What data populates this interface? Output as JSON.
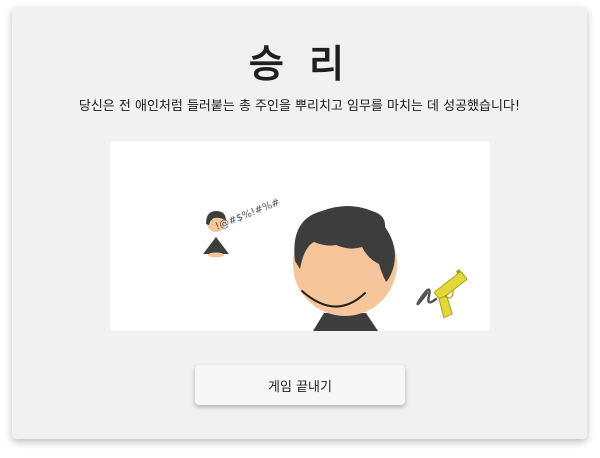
{
  "result": {
    "title": "승 리",
    "message": "당신은 전 애인처럼 들러붙는 총 주인을 뿌리치고 임무를 마치는 데 성공했습니다!"
  },
  "scene": {
    "curse_text": "!@#$%!#%#",
    "colors": {
      "hair": "#3d3d3d",
      "skin": "#f7c59a",
      "gun": "#e3d936"
    }
  },
  "actions": {
    "end_game_label": "게임 끝내기"
  }
}
